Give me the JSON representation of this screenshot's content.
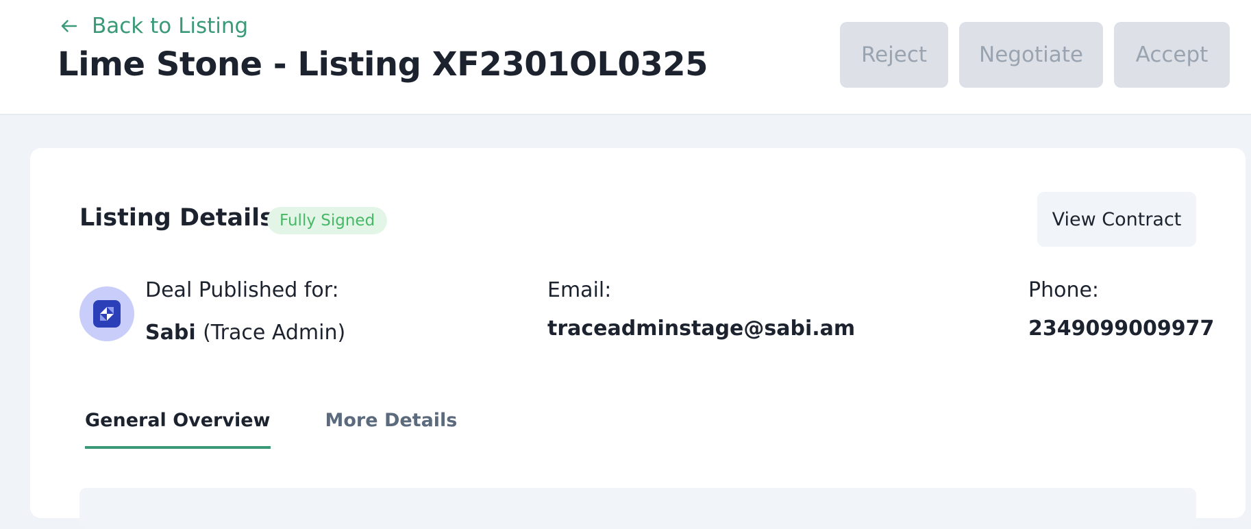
{
  "header": {
    "back_label": "Back to Listing",
    "title": "Lime Stone - Listing XF2301OL0325",
    "actions": {
      "reject": "Reject",
      "negotiate": "Negotiate",
      "accept": "Accept"
    }
  },
  "listing": {
    "section_title": "Listing Details",
    "status": "Fully Signed",
    "view_contract": "View Contract",
    "publisher_label": "Deal Published for:",
    "publisher_name": "Sabi",
    "publisher_role": "(Trace Admin)",
    "email_label": "Email:",
    "email": "traceadminstage@sabi.am",
    "phone_label": "Phone:",
    "phone": "2349099009977"
  },
  "tabs": [
    {
      "label": "General Overview",
      "active": true
    },
    {
      "label": "More Details",
      "active": false
    }
  ],
  "colors": {
    "accent": "#3a9a78",
    "badge_bg": "#e3f5e7",
    "badge_text": "#46b866",
    "disabled_btn_bg": "#dde1e7",
    "avatar_bg": "#c8cdfa",
    "avatar_logo": "#2a3fb8"
  },
  "icons": {
    "back": "arrow-left-icon",
    "avatar": "company-logo-icon"
  }
}
